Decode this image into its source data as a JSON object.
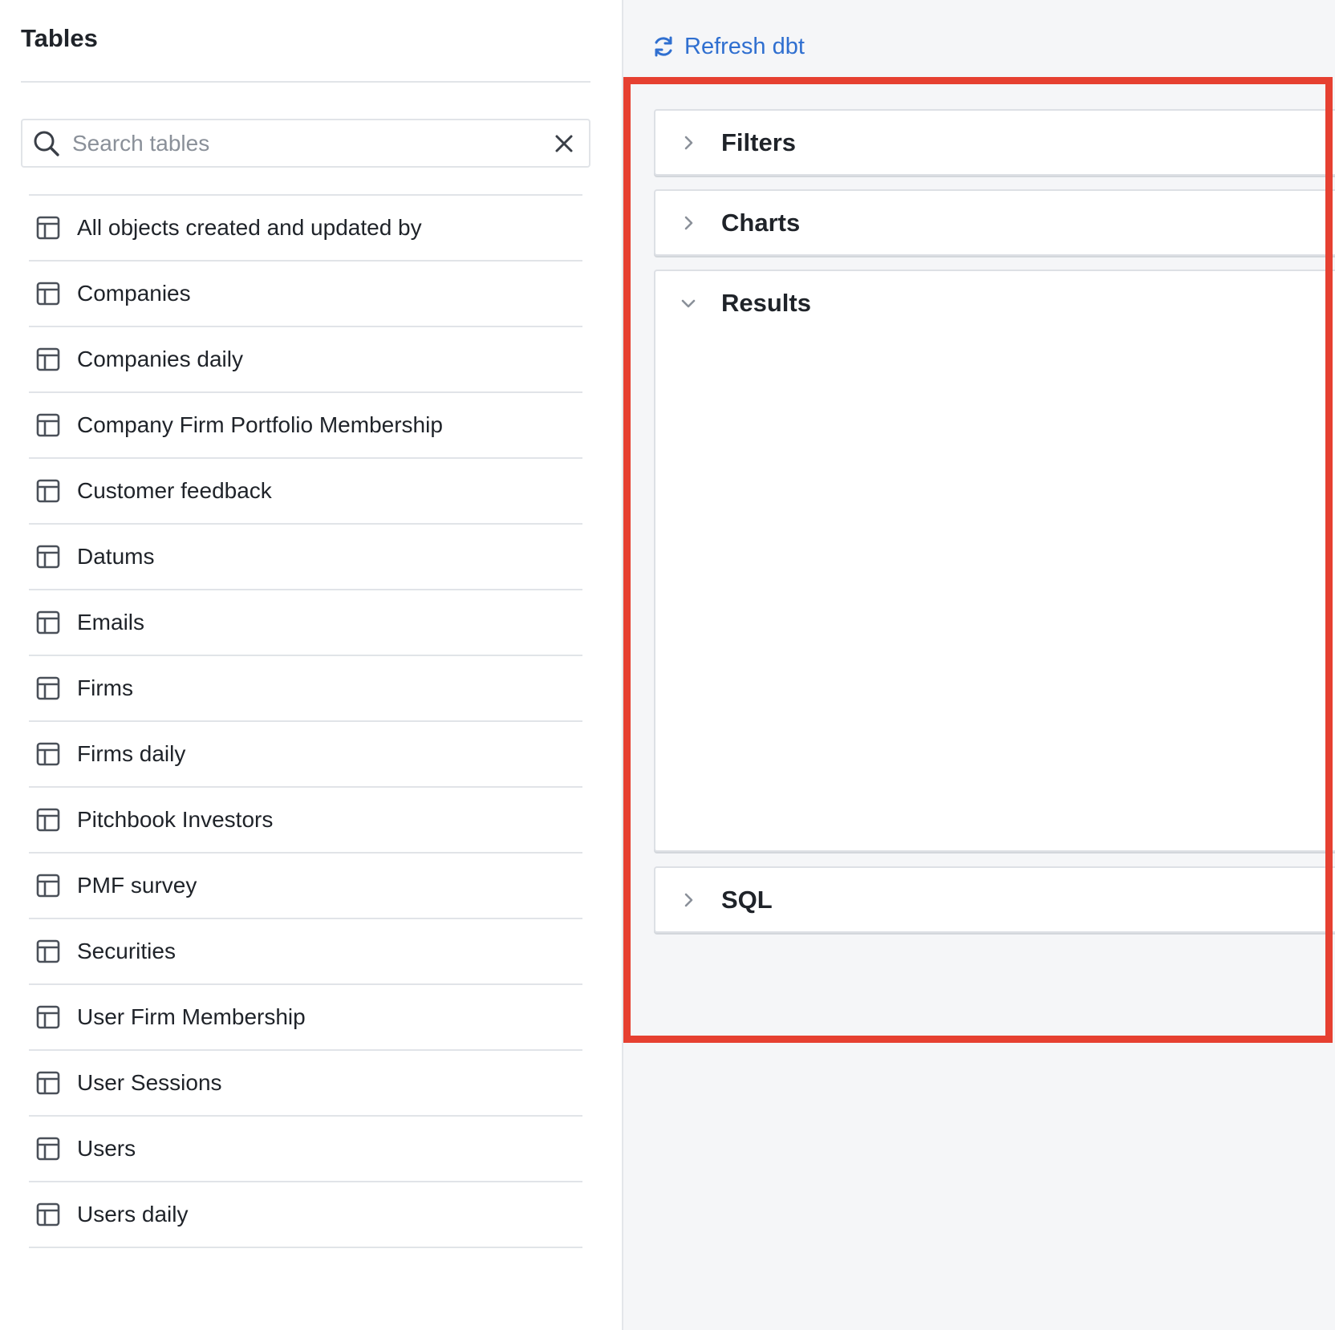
{
  "sidebar": {
    "title": "Tables",
    "search": {
      "placeholder": "Search tables",
      "value": ""
    },
    "tables": [
      {
        "label": "All objects created and updated by"
      },
      {
        "label": "Companies"
      },
      {
        "label": "Companies daily"
      },
      {
        "label": "Company Firm Portfolio Membership"
      },
      {
        "label": "Customer feedback"
      },
      {
        "label": "Datums"
      },
      {
        "label": "Emails"
      },
      {
        "label": "Firms"
      },
      {
        "label": "Firms daily"
      },
      {
        "label": "Pitchbook Investors"
      },
      {
        "label": "PMF survey"
      },
      {
        "label": "Securities"
      },
      {
        "label": "User Firm Membership"
      },
      {
        "label": "User Sessions"
      },
      {
        "label": "Users"
      },
      {
        "label": "Users daily"
      }
    ]
  },
  "main": {
    "refresh_label": "Refresh dbt",
    "panels": {
      "filters": {
        "title": "Filters",
        "expanded": false
      },
      "charts": {
        "title": "Charts",
        "expanded": false
      },
      "results": {
        "title": "Results",
        "expanded": true
      },
      "sql": {
        "title": "SQL",
        "expanded": false
      }
    }
  },
  "icons": {
    "search": "search-icon",
    "clear": "close-icon",
    "table": "table-icon",
    "refresh": "refresh-icon",
    "collapsed": "chevron-right-icon",
    "expanded": "chevron-down-icon"
  },
  "colors": {
    "accent": "#2f6fd0",
    "highlight": "#e64031",
    "main_background": "#f5f6f8",
    "border": "#e1e4e8"
  }
}
